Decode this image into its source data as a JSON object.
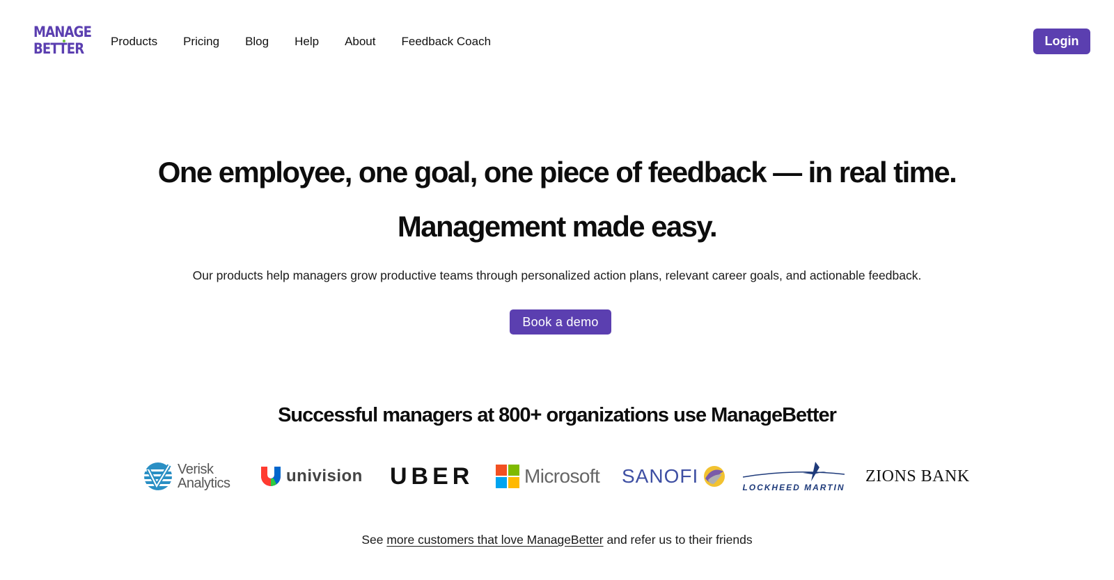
{
  "header": {
    "logo": {
      "line1": "MANAGE",
      "line2": "BETTER"
    },
    "nav": [
      {
        "label": "Products"
      },
      {
        "label": "Pricing"
      },
      {
        "label": "Blog"
      },
      {
        "label": "Help"
      },
      {
        "label": "About"
      },
      {
        "label": "Feedback Coach"
      }
    ],
    "login_label": "Login"
  },
  "hero": {
    "title": "One employee, one goal, one piece of feedback — in real time.",
    "subtitle": "Management made easy.",
    "description": "Our products help managers grow productive teams through personalized action plans, relevant career goals, and actionable feedback.",
    "cta_label": "Book a demo"
  },
  "customers": {
    "title": "Successful managers at 800+ organizations use ManageBetter",
    "logos": [
      {
        "name": "Verisk Analytics",
        "line1": "Verisk",
        "line2": "Analytics"
      },
      {
        "name": "Univision",
        "text": "univision"
      },
      {
        "name": "Uber",
        "text": "UBER"
      },
      {
        "name": "Microsoft",
        "text": "Microsoft"
      },
      {
        "name": "Sanofi",
        "text": "SANOFI"
      },
      {
        "name": "Lockheed Martin",
        "text": "LOCKHEED MARTIN"
      },
      {
        "name": "Zions Bank",
        "text": "ZIONS BANK"
      }
    ],
    "more_prefix": "See ",
    "more_link": "more customers that love ManageBetter",
    "more_suffix": " and refer us to their friends"
  },
  "colors": {
    "brand_purple": "#5b3fb0",
    "text": "#111111",
    "background": "#ffffff"
  }
}
